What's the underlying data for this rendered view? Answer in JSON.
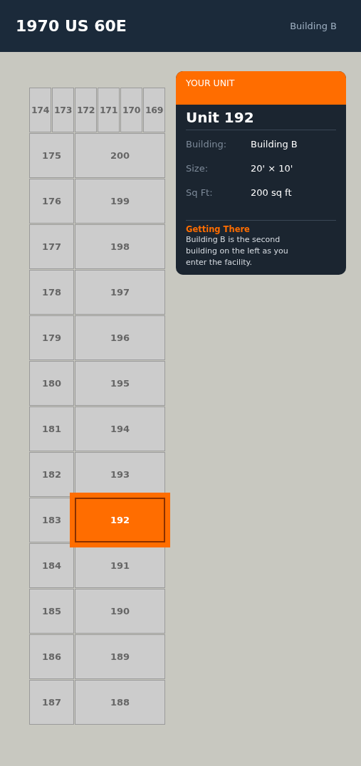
{
  "header": {
    "title": "1970 US 60E",
    "building": "Building B"
  },
  "top_row": [
    {
      "label": "174",
      "selected": false
    },
    {
      "label": "173",
      "selected": false
    },
    {
      "label": "172",
      "selected": false
    },
    {
      "label": "171",
      "selected": false
    },
    {
      "label": "170",
      "selected": false
    },
    {
      "label": "169",
      "selected": false
    }
  ],
  "rows": [
    {
      "left": {
        "label": "175",
        "selected": false
      },
      "right": {
        "label": "200",
        "selected": false
      }
    },
    {
      "left": {
        "label": "176",
        "selected": false
      },
      "right": {
        "label": "199",
        "selected": false
      }
    },
    {
      "left": {
        "label": "177",
        "selected": false
      },
      "right": {
        "label": "198",
        "selected": false
      }
    },
    {
      "left": {
        "label": "178",
        "selected": false
      },
      "right": {
        "label": "197",
        "selected": false
      }
    },
    {
      "left": {
        "label": "179",
        "selected": false
      },
      "right": {
        "label": "196",
        "selected": false
      }
    },
    {
      "left": {
        "label": "180",
        "selected": false
      },
      "right": {
        "label": "195",
        "selected": false
      }
    },
    {
      "left": {
        "label": "181",
        "selected": false
      },
      "right": {
        "label": "194",
        "selected": false
      }
    },
    {
      "left": {
        "label": "182",
        "selected": false
      },
      "right": {
        "label": "193",
        "selected": false
      }
    },
    {
      "left": {
        "label": "183",
        "selected": false
      },
      "right": {
        "label": "192",
        "selected": true
      }
    },
    {
      "left": {
        "label": "184",
        "selected": false
      },
      "right": {
        "label": "191",
        "selected": false
      }
    },
    {
      "left": {
        "label": "185",
        "selected": false
      },
      "right": {
        "label": "190",
        "selected": false
      }
    },
    {
      "left": {
        "label": "186",
        "selected": false
      },
      "right": {
        "label": "189",
        "selected": false
      }
    },
    {
      "left": {
        "label": "187",
        "selected": false
      },
      "right": {
        "label": "188",
        "selected": false
      }
    }
  ],
  "card": {
    "heading": "YOUR UNIT",
    "unit": "Unit 192",
    "details": [
      {
        "label": "Building:",
        "value": "Building B"
      },
      {
        "label": "Size:",
        "value": "20' × 10'"
      },
      {
        "label": "Sq Ft:",
        "value": "200 sq ft"
      }
    ],
    "directions_title": "Getting There",
    "directions": "Building B is the second building on the left as you enter the facility."
  }
}
